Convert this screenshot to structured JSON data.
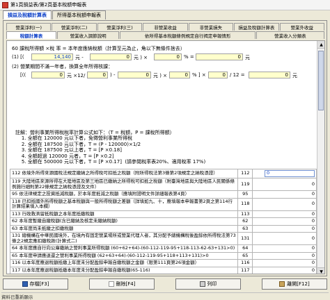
{
  "window": {
    "title": "第1頁損益表/第2頁基本稅額申報表"
  },
  "top_tabs": [
    {
      "label": "損益及稅額計算表",
      "active": true
    },
    {
      "label": "所得基本稅額申報表",
      "active": false
    }
  ],
  "sub_tabs_row1": [
    {
      "label": "營業淨利(一)"
    },
    {
      "label": "營業淨利(二)"
    },
    {
      "label": "營業淨利(三)"
    },
    {
      "label": "非營業收益"
    },
    {
      "label": "非營業損失"
    },
    {
      "label": "損益及稅額計算表"
    },
    {
      "label": "營業外收益"
    }
  ],
  "sub_tabs_row2": [
    {
      "label": "稅額計算表",
      "active": true
    },
    {
      "label": "營業收入調節說明",
      "active": false
    },
    {
      "label": "依所得基本稅額條例規定自行揭定申報情形",
      "active": false
    },
    {
      "label": "營業收入分類表",
      "active": false
    }
  ],
  "calc": {
    "line60": "60 課稅所得額 ×稅 率 = 本年度應納稅額（計算至元為止，角以下無條件捨去）",
    "row1_prefix": "(1) [(",
    "row1_value": "14,140",
    "row1_mid": "元 -",
    "row1_fld2": "0",
    "row1_after2": "元 ) ×",
    "row1_fld3": "0",
    "row1_after3": "% =",
    "row1_fld4": "0",
    "row1_end": "元",
    "row2": "(2) 營業期間不滿一年者，換算全年所得核課：",
    "row3_prefix": "[((",
    "row3_fld1": "0",
    "row3_a": "元 ×12/",
    "row3_fld2": "0",
    "row3_b": ") -",
    "row3_fld3": "0",
    "row3_c": "元 ) ×",
    "row3_fld4": "0",
    "row3_d": "% ] ×",
    "row3_fld5": "0",
    "row3_e": "/ 12 =",
    "row3_fld6": "0",
    "row3_end": "元",
    "note": "註解：營利事業所得稅稅率計算公式如下：（T = 稅額，P = 課稅所得額）\n    1. 全額在 120000 元以下者，免徵營利事業所得稅\n    2. 全額在 187500 元以下者，T = (P - 120000)×1/2\n    3. 全額在 187500 元以上者，T = [P ×0.18]\n    4. 全額超過 120000 元者，T = [P ×0.2]\n    5. 全額在 500000 元以下者，T = [P ×0.17]  (請參閱稅率表20%、適用稅率 17%)"
  },
  "rows": [
    {
      "desc": "112 依境外所得來源國稅法規定繳納之所得稅可扣抵之稅額（附所得稅法第3條第2項規定之納稅憑證）",
      "code": "112",
      "amount": "0",
      "boxed": true
    },
    {
      "desc": "119 大陸地區來源所得在大陸地區及第三地區已繳納之所得稅可扣抵之稅額（附臺灣地區與大陸地區人民關係條例施行細則第22條規定之納稅憑證及文件）",
      "code": "119",
      "amount": "0",
      "boxed": false
    },
    {
      "desc": "95 依法律規定之投資抵減稅額，於本年度抵減之稅額（應填附證明文件詳細報表第4頁）",
      "code": "95",
      "amount": "0",
      "boxed": false
    },
    {
      "desc": "118 已扣抵國外所得稅額之基本稅額與一般所得稅額之差額（詳填如九、十，應填報本申報書第2頁之第114行計算結果填入本欄）",
      "code": "118",
      "amount": "0",
      "boxed": false
    },
    {
      "desc": "113 行政救濟留抵稅額之本年度抵繳稅額",
      "code": "113",
      "amount": "0",
      "boxed": false
    },
    {
      "desc": "62 本年度暫繳自繳稅額(含已繳納及核定未繳納稅額)",
      "code": "62",
      "amount": "0",
      "boxed": false
    },
    {
      "desc": "63 本年度尚未抵繳之扣繳稅額",
      "code": "63",
      "amount": "0",
      "boxed": false
    },
    {
      "desc": "131 總機構在中華民國境外，在境內有固定營業場所或營業代理人者，其分配予總機構稅後盈餘依所得稅法第73條之2規定應扣繳稅款(計算式二)",
      "code": "131",
      "amount": "0",
      "boxed": false
    },
    {
      "desc": "64 本年度應自行向公庫繳納之營利事業所得稅額 (60+62+64)-(60-112-119-95+118-113-62-63+131>0)",
      "code": "64",
      "amount": "0",
      "boxed": false
    },
    {
      "desc": "65 本年度申請應退還之營利事業所得稅額 (62+63+64)-(60-112-119-95+118+113+131)>0",
      "code": "65",
      "amount": "0",
      "boxed": false
    },
    {
      "desc": "116 以本年度應退稅額抵繳上年度未分配盈餘申報自繳稅額之金額（限第111頁第26項金額）",
      "code": "116",
      "amount": "0",
      "boxed": false
    },
    {
      "desc": "117 以本年度應退稅額抵繳本年度未分配盈餘申報自繳稅額(65-116)",
      "code": "117",
      "amount": "0",
      "boxed": false
    }
  ],
  "buttons": {
    "save": "存檔[F3]",
    "delete": "刪除[F4]",
    "print": "列印",
    "exit": "離開[F12]"
  },
  "status_text": "資料已重新顯示",
  "colors": {
    "accent": "#0a3ec7",
    "field_bg": "#ffffcc",
    "frame_bg": "#ece9d8"
  }
}
